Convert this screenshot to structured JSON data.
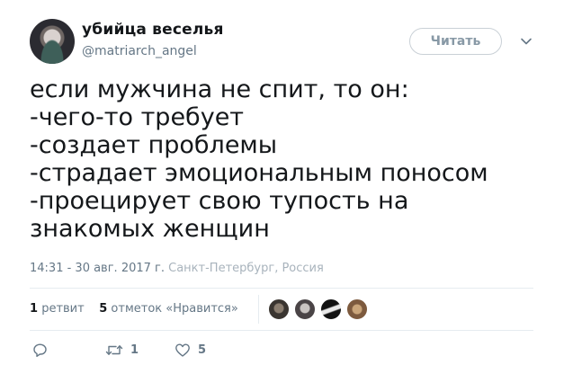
{
  "user": {
    "display_name": "убийца веселья",
    "handle": "@matriarch_angel"
  },
  "follow_button": {
    "label": "Читать"
  },
  "tweet": {
    "lines": [
      "если мужчина не спит, то он:",
      "-чего-то требует",
      "-создает проблемы",
      "-страдает эмоциональным поносом",
      "-проецирует свою тупость на",
      "знакомых женщин"
    ]
  },
  "meta": {
    "timestamp": "14:31 - 30 авг. 2017 г.",
    "location": "Санкт-Петербург, Россия"
  },
  "stats": {
    "retweets_count": "1",
    "retweets_label": "ретвит",
    "likes_count": "5",
    "likes_label": "отметок «Нравится»"
  },
  "actions": {
    "reply_icon": "reply-icon",
    "retweet_icon": "retweet-icon",
    "retweet_count": "1",
    "like_icon": "heart-icon",
    "like_count": "5"
  },
  "colors": {
    "text": "#14171a",
    "secondary": "#657786",
    "border": "#e6ecf0"
  }
}
